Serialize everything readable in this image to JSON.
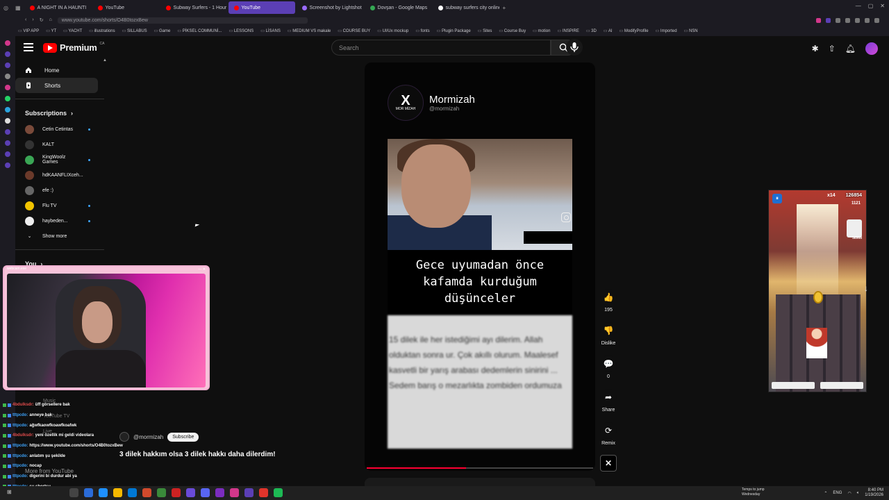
{
  "browser": {
    "tabs": [
      {
        "label": "A NIGHT IN A HAUNTI",
        "color": "#ff0000",
        "active": false
      },
      {
        "label": "YouTube",
        "color": "#ff0000",
        "active": false
      },
      {
        "label": "Subway Surfers - 1 Hour",
        "color": "#ff0000",
        "active": false
      },
      {
        "label": "YouTube",
        "color": "#ff0000",
        "active": true
      },
      {
        "label": "Screenshot by Lightshot",
        "color": "#9a6bff",
        "active": false
      },
      {
        "label": "Dovşan - Google Maps",
        "color": "#34a853",
        "active": false
      },
      {
        "label": "subway surfers city online",
        "color": "#ffffff",
        "active": false
      }
    ],
    "url": "www.youtube.com/shorts/O4B0tozxBew",
    "bookmarks": [
      "VIP APP",
      "YT",
      "YACHT",
      "illustrations",
      "SILLABUS",
      "Game",
      "PİKSEL COMMUNİ...",
      "LESSONS",
      "LİSANS",
      "MEDIUM VS makale",
      "COURSE BUY",
      "UI/Ux mockup",
      "fonts",
      "Plugin Package",
      "Sites",
      "Course Buy",
      "motion",
      "INSPIRE",
      "3D",
      "AI",
      "ModifyProfile",
      "Imported",
      "NSN"
    ]
  },
  "youtube": {
    "logo_text": "Premium",
    "logo_region": "CA",
    "search_placeholder": "Search",
    "sidebar": {
      "home": "Home",
      "shorts": "Shorts",
      "subscriptions_title": "Subscriptions",
      "subscriptions": [
        {
          "name": "Cetin Cetintas",
          "color": "#7a4a3a",
          "new": true
        },
        {
          "name": "KALT",
          "color": "#333333",
          "new": false
        },
        {
          "name": "KingWoolz Games",
          "color": "#3aa655",
          "new": true
        },
        {
          "name": "hdKAANFLIXceh...",
          "color": "#6b3a2a",
          "new": true
        },
        {
          "name": "efe :)",
          "color": "#666666",
          "new": false
        },
        {
          "name": "Flu TV",
          "color": "#f2c400",
          "new": true
        },
        {
          "name": "haybeden...",
          "color": "#eeeeee",
          "new": true
        }
      ],
      "show_more": "Show more",
      "you_title": "You"
    },
    "short": {
      "channel_name": "Mormizah",
      "channel_handle": "@mormizah",
      "logo_mark": "X",
      "logo_sub": "MOR MİZAH",
      "overlay_text": "Gece uyumadan önce kafamda kurduğum düşünceler",
      "blurred_text": "15 dilek ile her istediğimi ayı dilerim. Allah olduktan sonra ur. Çok akıllı olurum. Maalesef kasvetli bir yarış arabası dedemlerin sinirini ... Sedem barış o mezarlıkta zombiden ordumuza",
      "progress": 0.44
    },
    "actions": [
      {
        "name": "like",
        "icon": "👍",
        "label": "195"
      },
      {
        "name": "dislike",
        "icon": "👎",
        "label": "Dislike"
      },
      {
        "name": "comments",
        "icon": "💬",
        "label": "0"
      },
      {
        "name": "share",
        "icon": "➦",
        "label": "Share"
      },
      {
        "name": "remix",
        "icon": "⟳",
        "label": "Remix"
      }
    ]
  },
  "overlay": {
    "webcam_title": "webcam.exe",
    "chat": [
      {
        "user": "4bdulksdr:",
        "msg": "üff görsellere bak",
        "color": "#e04b4b"
      },
      {
        "user": "tttpcdo:",
        "msg": "anneye bak",
        "color": "#3ea6ff"
      },
      {
        "user": "tttpcdo:",
        "msg": "ağwfkaowfkoawfkoafwk",
        "color": "#3ea6ff"
      },
      {
        "user": "4bdulksdr:",
        "msg": "yeni özellik mi geldi videolara",
        "color": "#e04b4b"
      },
      {
        "user": "tttpcdo:",
        "msg": "https://www.youtube.com/shorts/O4B0tozxBew",
        "color": "#3ea6ff"
      },
      {
        "user": "tttpcdo:",
        "msg": "anlatım şu şekilde",
        "color": "#3ea6ff"
      },
      {
        "user": "tttpcdo:",
        "msg": "nocap",
        "color": "#3ea6ff"
      },
      {
        "user": "tttpcdo:",
        "msg": "digerini bi durdur abi ya",
        "color": "#3ea6ff"
      },
      {
        "user": "tttpcdo:",
        "msg": "şu shortsu",
        "color": "#3ea6ff"
      }
    ],
    "ghost_music": "Music",
    "ghost_tv": "YouTube TV",
    "ghost_live": "Live",
    "ghost_more": "More from YouTube",
    "sub_handle": "@mormizah",
    "subscribe": "Subscribe",
    "caption": "3 dilek hakkım olsa 3 dilek hakkı daha dilerdim!"
  },
  "game": {
    "multiplier": "x14",
    "score": "126854",
    "coins": "1121",
    "sub_value": "58968"
  },
  "taskbar": {
    "weather_line1": "Temps to jump",
    "weather_line2": "Wednesday",
    "lang": "ENG",
    "time": "8:40 PM",
    "date": "1/19/2026"
  }
}
